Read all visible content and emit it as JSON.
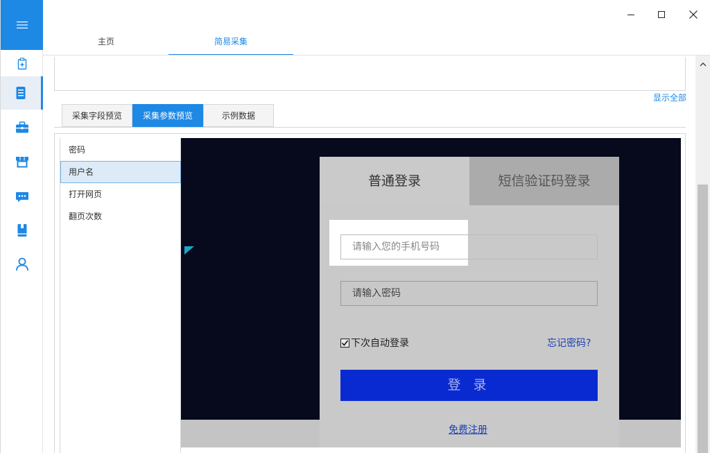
{
  "window": {
    "minimize_icon": "minimize-icon",
    "maximize_icon": "maximize-icon",
    "close_icon": "close-icon"
  },
  "rail": {
    "menu_icon": "hamburger-icon",
    "items": [
      {
        "icon": "clipboard-add-icon"
      },
      {
        "icon": "document-icon"
      },
      {
        "icon": "briefcase-icon"
      },
      {
        "icon": "store-icon"
      },
      {
        "icon": "chat-icon"
      },
      {
        "icon": "book-icon"
      },
      {
        "icon": "user-icon"
      }
    ],
    "accent": "#1e88e5"
  },
  "top_tabs": [
    {
      "label": "主页"
    },
    {
      "label": "简易采集"
    }
  ],
  "show_all_label": "显示全部",
  "sub_tabs": [
    {
      "label": "采集字段预览"
    },
    {
      "label": "采集参数预览"
    },
    {
      "label": "示例数据"
    }
  ],
  "params": [
    {
      "label": "密码"
    },
    {
      "label": "用户名"
    },
    {
      "label": "打开网页"
    },
    {
      "label": "翻页次数"
    }
  ],
  "preview": {
    "tab_normal": "普通登录",
    "tab_sms": "短信验证码登录",
    "phone_placeholder": "请输入您的手机号码",
    "password_placeholder": "请输入密码",
    "auto_login": "下次自动登录",
    "forgot": "忘记密码?",
    "login_button": "登 录",
    "register": "免费注册"
  }
}
